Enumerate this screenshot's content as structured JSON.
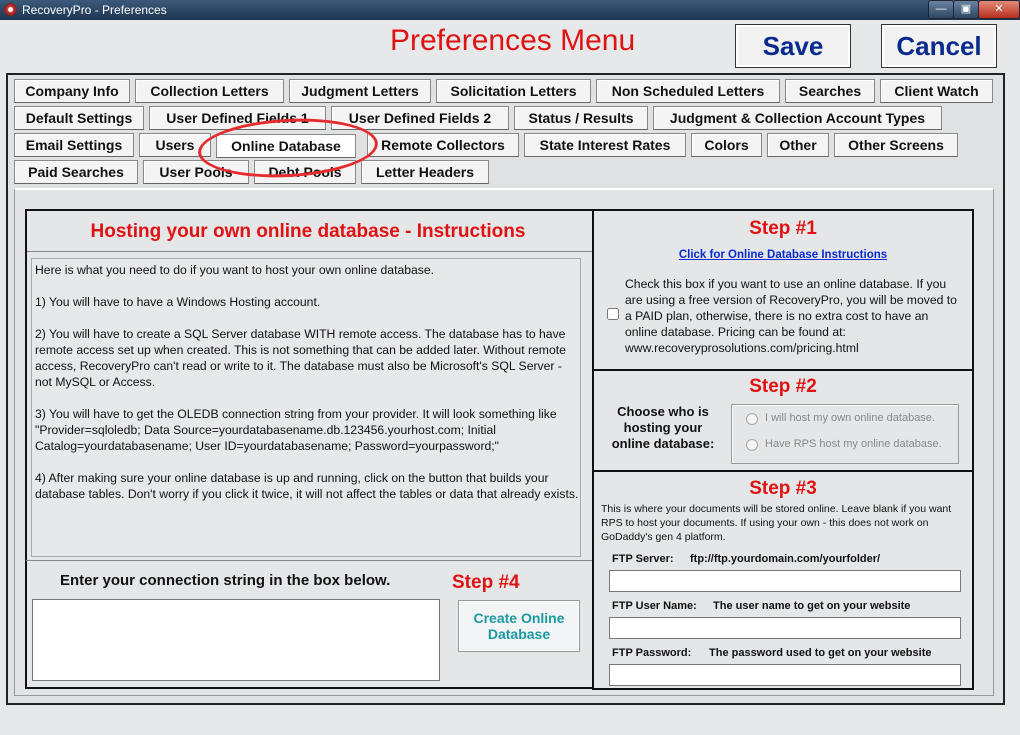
{
  "window": {
    "title": "RecoveryPro - Preferences",
    "minimize": "—",
    "maximize": "▣",
    "close": "✕"
  },
  "header": {
    "title": "Preferences Menu",
    "save": "Save",
    "cancel": "Cancel"
  },
  "tabs": {
    "company_info": "Company Info",
    "collection_letters": "Collection Letters",
    "judgment_letters": "Judgment Letters",
    "solicitation_letters": "Solicitation Letters",
    "non_scheduled_letters": "Non Scheduled Letters",
    "searches": "Searches",
    "client_watch": "Client Watch",
    "default_settings": "Default Settings",
    "user_defined_fields_1": "User Defined Fields 1",
    "user_defined_fields_2": "User Defined Fields 2",
    "status_results": "Status / Results",
    "judgment_collection_types": "Judgment & Collection Account Types",
    "email_settings": "Email Settings",
    "users": "Users",
    "online_database": "Online Database",
    "remote_collectors": "Remote Collectors",
    "state_interest_rates": "State Interest Rates",
    "colors": "Colors",
    "other": "Other",
    "other_screens": "Other Screens",
    "paid_searches": "Paid Searches",
    "user_pools": "User Pools",
    "debt_pools": "Debt Pools",
    "letter_headers": "Letter Headers"
  },
  "instructions": {
    "title": "Hosting your own online database - Instructions",
    "p1": "Here is what you need to do if you want to host your own online database.",
    "p2": "1) You will have to have a Windows Hosting account.",
    "p3": "2) You will have to create a SQL Server database WITH remote access.  The database has to have remote access set up when created.  This is not something that can be added later.  Without remote access, RecoveryPro can't read or write to it.  The database must also be Microsoft's SQL Server - not MySQL or Access.",
    "p4": "3) You will have to get the OLEDB connection string from your provider.  It will look something like \"Provider=sqloledb; Data Source=yourdatabasename.db.123456.yourhost.com; Initial Catalog=yourdatabasename; User ID=yourdatabasename; Password=yourpassword;\"",
    "p5": "4) After making sure your online database is up and running, click on the button that builds your database tables.  Don't worry if you click it twice, it will not affect the tables or data that already exists."
  },
  "step1": {
    "title": "Step #1",
    "link": "Click for Online Database Instructions",
    "checkbox_text": "Check this box if you want to use an online database.  If you are using a free version of RecoveryPro, you will be moved to a PAID plan, otherwise, there is no extra cost to have an online database.  Pricing can be found at: www.recoveryprosolutions.com/pricing.html",
    "checked": false
  },
  "step2": {
    "title": "Step #2",
    "prompt": "Choose who is hosting your online database:",
    "option_self": "I will host my own online database.",
    "option_rps": "Have RPS host my online database."
  },
  "step3": {
    "title": "Step #3",
    "description": "This is where your documents will be stored online.  Leave blank if you want RPS to host your documents.  If using your own - this does not work on GoDaddy's gen 4 platform.",
    "ftp_server_label": "FTP Server:",
    "ftp_server_hint": "ftp://ftp.yourdomain.com/yourfolder/",
    "ftp_server_value": "",
    "ftp_user_label": "FTP User Name:",
    "ftp_user_hint": "The user name to get on your website",
    "ftp_user_value": "",
    "ftp_password_label": "FTP Password:",
    "ftp_password_hint": "The password used to get on your website",
    "ftp_password_value": ""
  },
  "step4": {
    "title": "Step #4",
    "prompt": "Enter your connection string in the box below.",
    "connection_string": "",
    "create_button": "Create Online Database"
  }
}
